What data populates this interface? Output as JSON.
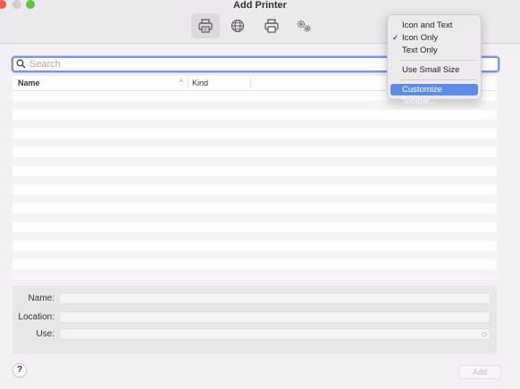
{
  "window": {
    "title": "Add Printer",
    "colors": {
      "accent": "#5d8ce8",
      "close": "#ee5b54",
      "maximize": "#5ec440"
    }
  },
  "toolbar": {
    "items": [
      {
        "icon": "default-printer-icon",
        "selected": true
      },
      {
        "icon": "ip-globe-icon",
        "selected": false
      },
      {
        "icon": "windows-printer-icon",
        "selected": false
      },
      {
        "icon": "advanced-gears-icon",
        "selected": false
      }
    ]
  },
  "search": {
    "placeholder": "Search",
    "value": ""
  },
  "list": {
    "columns": [
      "Name",
      "Kind"
    ],
    "sort_indicator": "^",
    "rows": []
  },
  "form": {
    "name_label": "Name:",
    "location_label": "Location:",
    "use_label": "Use:",
    "name_value": "",
    "location_value": "",
    "use_value": "",
    "stepper_glyph": "◇"
  },
  "footer": {
    "help_label": "?",
    "add_label": "Add"
  },
  "context_menu": {
    "items": [
      {
        "label": "Icon and Text",
        "checked": false
      },
      {
        "label": "Icon Only",
        "checked": true,
        "check_glyph": "✓"
      },
      {
        "label": "Text Only",
        "checked": false
      },
      {
        "label": "Use Small Size",
        "checked": false
      },
      {
        "label": "Customize Toolbar...",
        "highlighted": true
      }
    ]
  }
}
